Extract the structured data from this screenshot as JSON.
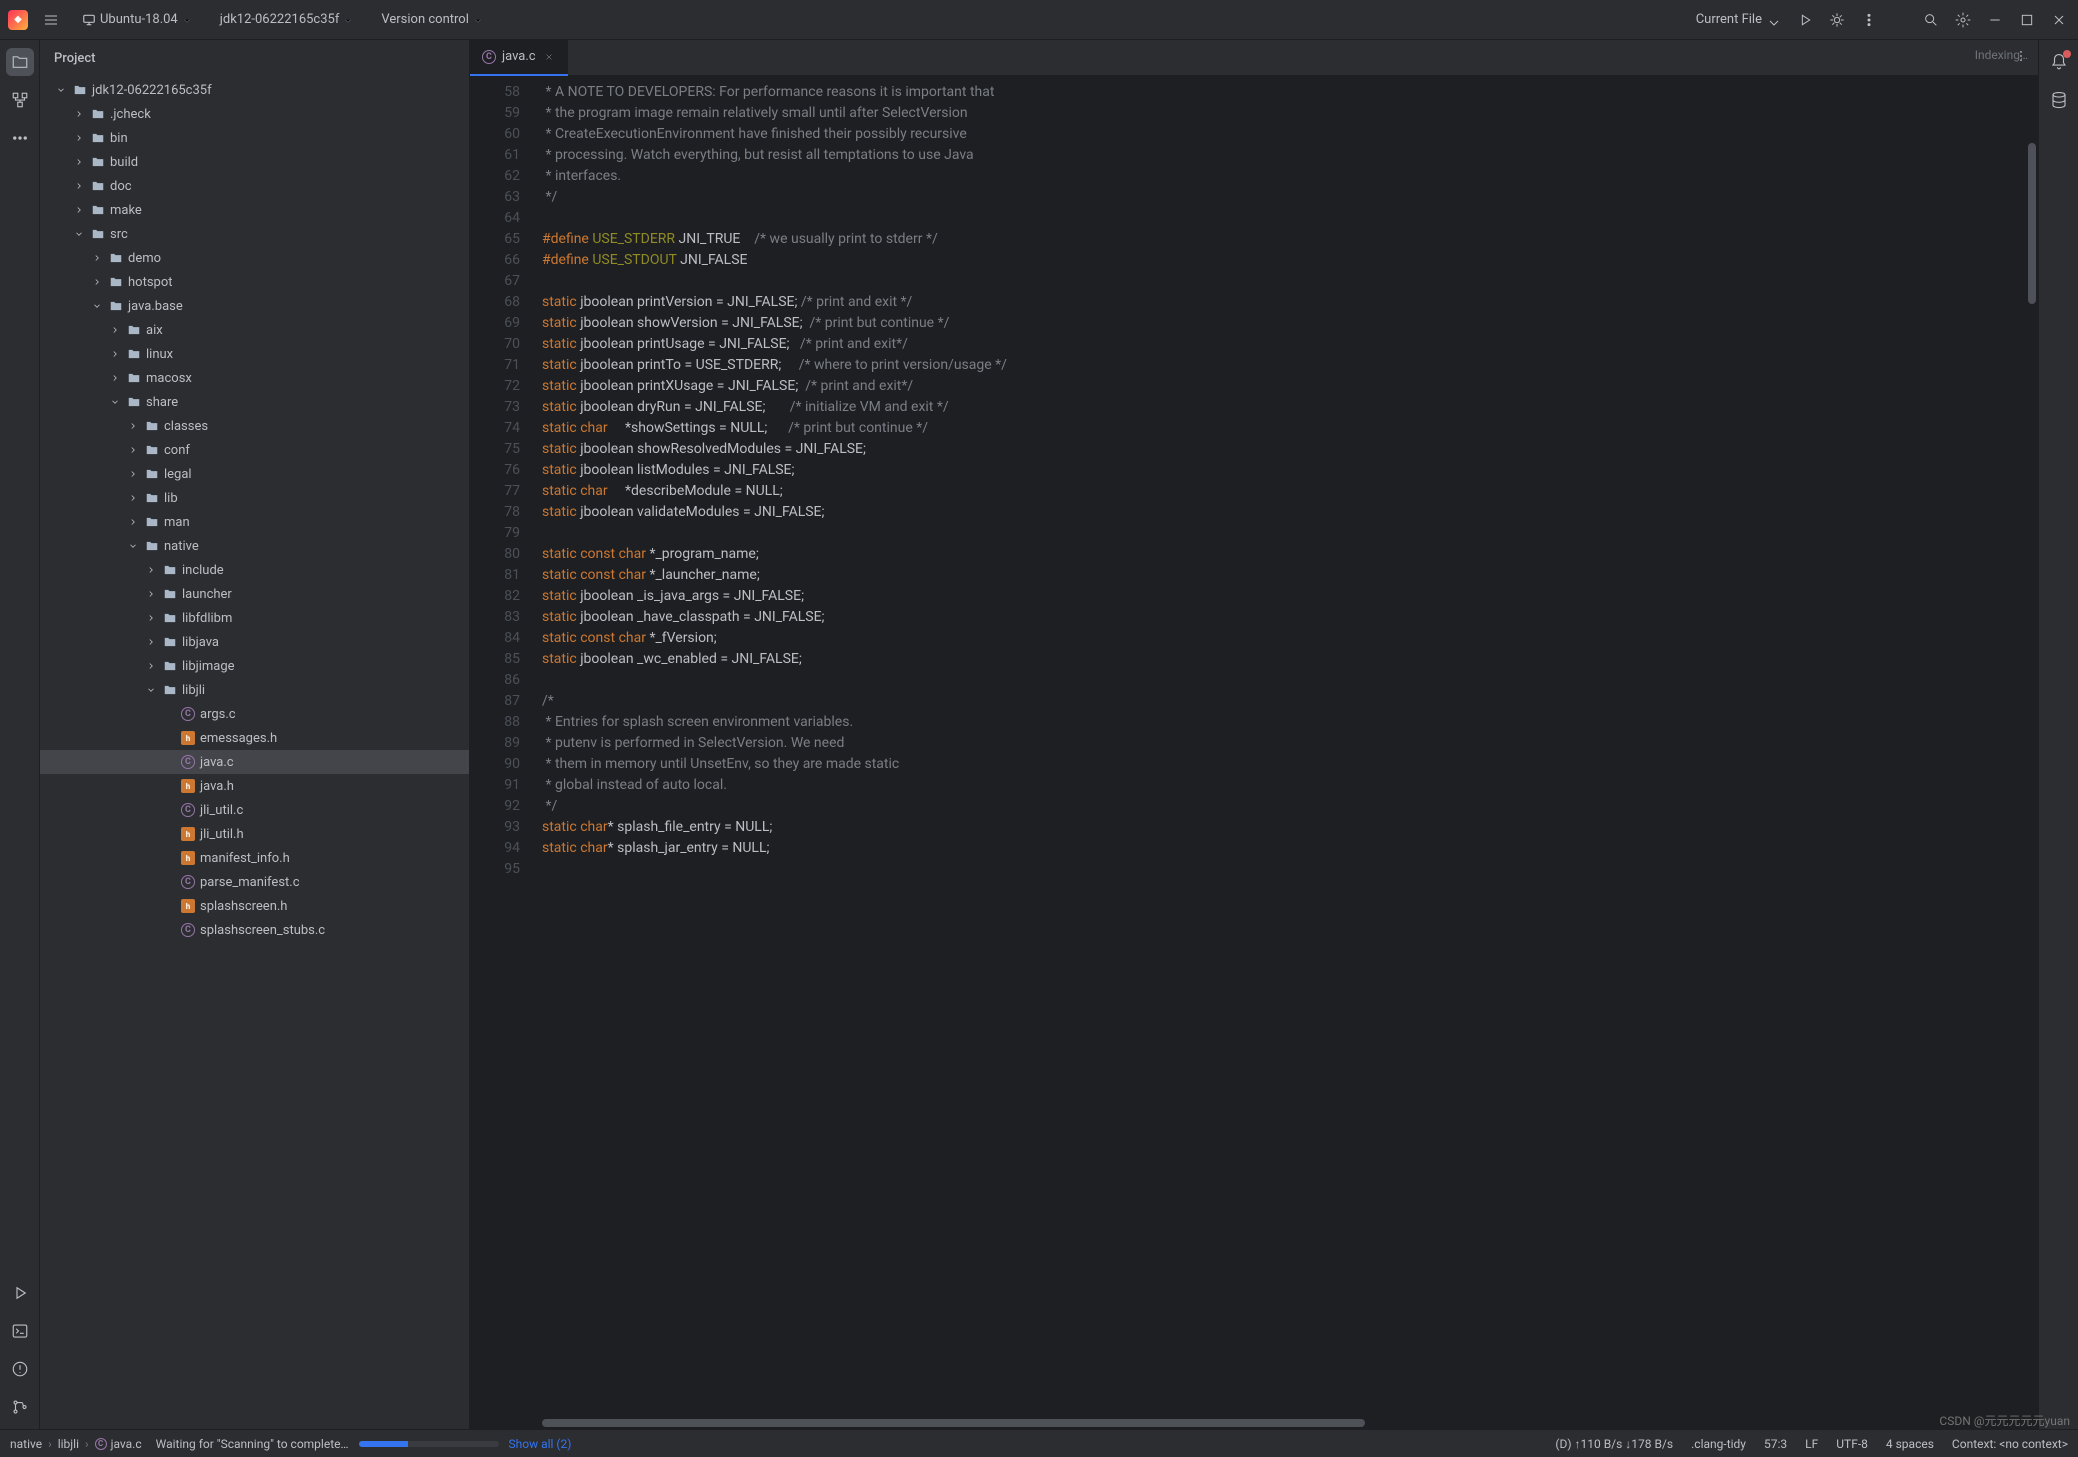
{
  "titlebar": {
    "env": "Ubuntu-18.04",
    "project": "jdk12-06222165c35f",
    "version_control": "Version control",
    "current_file": "Current File"
  },
  "project_panel": {
    "title": "Project"
  },
  "tree": [
    {
      "d": 0,
      "exp": true,
      "icon": "folder",
      "label": "jdk12-06222165c35f"
    },
    {
      "d": 1,
      "exp": false,
      "icon": "folder",
      "label": ".jcheck"
    },
    {
      "d": 1,
      "exp": false,
      "icon": "folder",
      "label": "bin"
    },
    {
      "d": 1,
      "exp": false,
      "icon": "folder",
      "label": "build"
    },
    {
      "d": 1,
      "exp": false,
      "icon": "folder",
      "label": "doc"
    },
    {
      "d": 1,
      "exp": false,
      "icon": "folder",
      "label": "make"
    },
    {
      "d": 1,
      "exp": true,
      "icon": "folder",
      "label": "src"
    },
    {
      "d": 2,
      "exp": false,
      "icon": "folder",
      "label": "demo"
    },
    {
      "d": 2,
      "exp": false,
      "icon": "folder",
      "label": "hotspot"
    },
    {
      "d": 2,
      "exp": true,
      "icon": "folder",
      "label": "java.base"
    },
    {
      "d": 3,
      "exp": false,
      "icon": "folder",
      "label": "aix"
    },
    {
      "d": 3,
      "exp": false,
      "icon": "folder",
      "label": "linux"
    },
    {
      "d": 3,
      "exp": false,
      "icon": "folder",
      "label": "macosx"
    },
    {
      "d": 3,
      "exp": true,
      "icon": "folder",
      "label": "share"
    },
    {
      "d": 4,
      "exp": false,
      "icon": "folder",
      "label": "classes"
    },
    {
      "d": 4,
      "exp": false,
      "icon": "folder",
      "label": "conf"
    },
    {
      "d": 4,
      "exp": false,
      "icon": "folder",
      "label": "legal"
    },
    {
      "d": 4,
      "exp": false,
      "icon": "folder",
      "label": "lib"
    },
    {
      "d": 4,
      "exp": false,
      "icon": "folder",
      "label": "man"
    },
    {
      "d": 4,
      "exp": true,
      "icon": "folder",
      "label": "native"
    },
    {
      "d": 5,
      "exp": false,
      "icon": "folder",
      "label": "include"
    },
    {
      "d": 5,
      "exp": false,
      "icon": "folder",
      "label": "launcher"
    },
    {
      "d": 5,
      "exp": false,
      "icon": "folder",
      "label": "libfdlibm"
    },
    {
      "d": 5,
      "exp": false,
      "icon": "folder",
      "label": "libjava"
    },
    {
      "d": 5,
      "exp": false,
      "icon": "folder",
      "label": "libjimage"
    },
    {
      "d": 5,
      "exp": true,
      "icon": "folder",
      "label": "libjli"
    },
    {
      "d": 6,
      "icon": "c",
      "label": "args.c"
    },
    {
      "d": 6,
      "icon": "h",
      "label": "emessages.h"
    },
    {
      "d": 6,
      "icon": "c",
      "label": "java.c",
      "selected": true
    },
    {
      "d": 6,
      "icon": "h",
      "label": "java.h"
    },
    {
      "d": 6,
      "icon": "c",
      "label": "jli_util.c"
    },
    {
      "d": 6,
      "icon": "h",
      "label": "jli_util.h"
    },
    {
      "d": 6,
      "icon": "h",
      "label": "manifest_info.h"
    },
    {
      "d": 6,
      "icon": "c",
      "label": "parse_manifest.c"
    },
    {
      "d": 6,
      "icon": "h",
      "label": "splashscreen.h"
    },
    {
      "d": 6,
      "icon": "c",
      "label": "splashscreen_stubs.c"
    }
  ],
  "tab": {
    "filename": "java.c"
  },
  "indexing": "Indexing…",
  "editor": {
    "first_line": 58,
    "lines": [
      [
        [
          "cmt",
          " * A NOTE TO DEVELOPERS: For performance reasons it is important that"
        ]
      ],
      [
        [
          "cmt",
          " * the program image remain relatively small until after SelectVersion"
        ]
      ],
      [
        [
          "cmt",
          " * CreateExecutionEnvironment have finished their possibly recursive"
        ]
      ],
      [
        [
          "cmt",
          " * processing. Watch everything, but resist all temptations to use Java"
        ]
      ],
      [
        [
          "cmt",
          " * interfaces."
        ]
      ],
      [
        [
          "cmt",
          " */"
        ]
      ],
      [
        [
          "",
          ""
        ]
      ],
      [
        [
          "pp",
          "#define "
        ],
        [
          "mac",
          "USE_STDERR"
        ],
        [
          "",
          " JNI_TRUE    "
        ],
        [
          "cmt",
          "/* we usually print to stderr */"
        ]
      ],
      [
        [
          "pp",
          "#define "
        ],
        [
          "mac",
          "USE_STDOUT"
        ],
        [
          "",
          " JNI_FALSE"
        ]
      ],
      [
        [
          "",
          ""
        ]
      ],
      [
        [
          "kw",
          "static"
        ],
        [
          "",
          " jboolean printVersion = JNI_FALSE; "
        ],
        [
          "cmt",
          "/* print and exit */"
        ]
      ],
      [
        [
          "kw",
          "static"
        ],
        [
          "",
          " jboolean showVersion = JNI_FALSE;  "
        ],
        [
          "cmt",
          "/* print but continue */"
        ]
      ],
      [
        [
          "kw",
          "static"
        ],
        [
          "",
          " jboolean printUsage = JNI_FALSE;   "
        ],
        [
          "cmt",
          "/* print and exit*/"
        ]
      ],
      [
        [
          "kw",
          "static"
        ],
        [
          "",
          " jboolean printTo = USE_STDERR;     "
        ],
        [
          "cmt",
          "/* where to print version/usage */"
        ]
      ],
      [
        [
          "kw",
          "static"
        ],
        [
          "",
          " jboolean printXUsage = JNI_FALSE;  "
        ],
        [
          "cmt",
          "/* print and exit*/"
        ]
      ],
      [
        [
          "kw",
          "static"
        ],
        [
          "",
          " jboolean dryRun = JNI_FALSE;       "
        ],
        [
          "cmt",
          "/* initialize VM and exit */"
        ]
      ],
      [
        [
          "kw",
          "static"
        ],
        [
          "",
          " "
        ],
        [
          "kw",
          "char"
        ],
        [
          "",
          "     *showSettings = NULL;      "
        ],
        [
          "cmt",
          "/* print but continue */"
        ]
      ],
      [
        [
          "kw",
          "static"
        ],
        [
          "",
          " jboolean showResolvedModules = JNI_FALSE;"
        ]
      ],
      [
        [
          "kw",
          "static"
        ],
        [
          "",
          " jboolean listModules = JNI_FALSE;"
        ]
      ],
      [
        [
          "kw",
          "static"
        ],
        [
          "",
          " "
        ],
        [
          "kw",
          "char"
        ],
        [
          "",
          "     *describeModule = NULL;"
        ]
      ],
      [
        [
          "kw",
          "static"
        ],
        [
          "",
          " jboolean validateModules = JNI_FALSE;"
        ]
      ],
      [
        [
          "",
          ""
        ]
      ],
      [
        [
          "kw",
          "static"
        ],
        [
          "",
          " "
        ],
        [
          "kw",
          "const"
        ],
        [
          "",
          " "
        ],
        [
          "kw",
          "char"
        ],
        [
          "",
          " *_program_name;"
        ]
      ],
      [
        [
          "kw",
          "static"
        ],
        [
          "",
          " "
        ],
        [
          "kw",
          "const"
        ],
        [
          "",
          " "
        ],
        [
          "kw",
          "char"
        ],
        [
          "",
          " *_launcher_name;"
        ]
      ],
      [
        [
          "kw",
          "static"
        ],
        [
          "",
          " jboolean _is_java_args = JNI_FALSE;"
        ]
      ],
      [
        [
          "kw",
          "static"
        ],
        [
          "",
          " jboolean _have_classpath = JNI_FALSE;"
        ]
      ],
      [
        [
          "kw",
          "static"
        ],
        [
          "",
          " "
        ],
        [
          "kw",
          "const"
        ],
        [
          "",
          " "
        ],
        [
          "kw",
          "char"
        ],
        [
          "",
          " *_fVersion;"
        ]
      ],
      [
        [
          "kw",
          "static"
        ],
        [
          "",
          " jboolean _wc_enabled = JNI_FALSE;"
        ]
      ],
      [
        [
          "",
          ""
        ]
      ],
      [
        [
          "cmt",
          "/*"
        ]
      ],
      [
        [
          "cmt",
          " * Entries for splash screen environment variables."
        ]
      ],
      [
        [
          "cmt",
          " * putenv is performed in SelectVersion. We need"
        ]
      ],
      [
        [
          "cmt",
          " * them in memory until UnsetEnv, so they are made static"
        ]
      ],
      [
        [
          "cmt",
          " * global instead of auto local."
        ]
      ],
      [
        [
          "cmt",
          " */"
        ]
      ],
      [
        [
          "kw",
          "static"
        ],
        [
          "",
          " "
        ],
        [
          "kw",
          "char"
        ],
        [
          "",
          "* splash_file_entry = NULL;"
        ]
      ],
      [
        [
          "kw",
          "static"
        ],
        [
          "",
          " "
        ],
        [
          "kw",
          "char"
        ],
        [
          "",
          "* splash_jar_entry = NULL;"
        ]
      ],
      [
        [
          "",
          ""
        ]
      ]
    ]
  },
  "breadcrumbs": [
    "native",
    "libjli",
    "java.c"
  ],
  "status": {
    "waiting": "Waiting for \"Scanning\" to complete…",
    "show_all": "Show all (2)",
    "net": "(D) ↑110 B/s  ↓178 B/s",
    "clang": ".clang-tidy",
    "pos": "57:3",
    "le": "LF",
    "enc": "UTF-8",
    "indent": "4 spaces",
    "context": "Context: <no context>"
  },
  "watermark": "CSDN @元元元元元yuan"
}
